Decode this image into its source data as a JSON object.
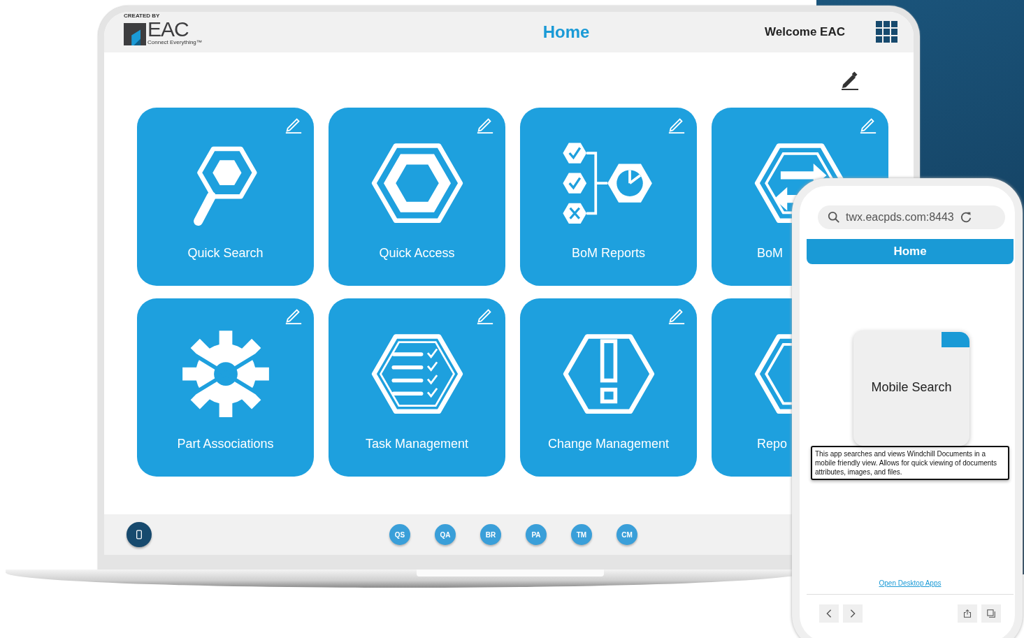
{
  "laptop": {
    "logo": {
      "caption": "CREATED BY",
      "name": "EAC",
      "tagline": "Connect Everything™"
    },
    "header": {
      "title": "Home",
      "welcome": "Welcome EAC"
    },
    "tiles": [
      {
        "label": "Quick Search",
        "kind": "full"
      },
      {
        "label": "Quick Access",
        "kind": "full"
      },
      {
        "label": "BoM Reports",
        "kind": "full"
      },
      {
        "label": "BoM",
        "kind": "partial"
      },
      {
        "label": "Part Associations",
        "kind": "full"
      },
      {
        "label": "Task Management",
        "kind": "full"
      },
      {
        "label": "Change Management",
        "kind": "full"
      },
      {
        "label": "Repo",
        "kind": "covered"
      }
    ],
    "shortcuts": [
      "QS",
      "QA",
      "BR",
      "PA",
      "TM",
      "CM"
    ]
  },
  "phone": {
    "address": "twx.eacpds.com:8443",
    "title": "Home",
    "card": {
      "label": "Mobile Search"
    },
    "tooltip": "This app searches and views Windchill Documents in a mobile friendly view. Allows for quick viewing of documents attributes, images, and files.",
    "link": "Open Desktop Apps"
  }
}
